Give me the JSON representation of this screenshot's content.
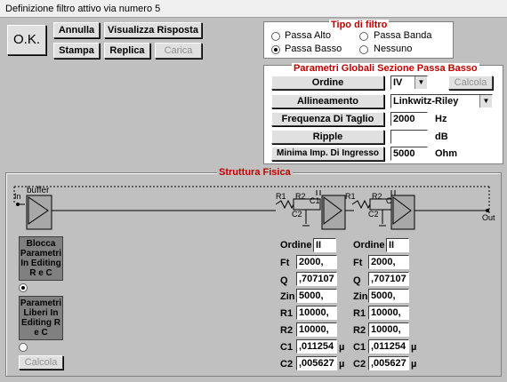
{
  "window": {
    "title": "Definizione filtro attivo via numero 5"
  },
  "toolbar": {
    "ok": "O.K.",
    "annulla": "Annulla",
    "visualizza": "Visualizza Risposta",
    "stampa": "Stampa",
    "replica": "Replica",
    "carica": "Carica"
  },
  "tipo_filtro": {
    "title": "Tipo di filtro",
    "options": [
      "Passa Alto",
      "Passa Banda",
      "Passa Basso",
      "Nessuno"
    ],
    "selected": "Passa Basso"
  },
  "parametri": {
    "title": "Parametri Globali Sezione Passa Basso",
    "ordine_label": "Ordine",
    "ordine_value": "IV",
    "calcola": "Calcola",
    "allineamento_label": "Allineamento",
    "allineamento_value": "Linkwitz-Riley",
    "frequenza_label": "Frequenza Di Taglio",
    "frequenza_value": "2000",
    "frequenza_unit": "Hz",
    "ripple_label": "Ripple",
    "ripple_value": "",
    "ripple_unit": "dB",
    "minima_label": "Minima Imp. Di Ingresso",
    "minima_value": "5000",
    "minima_unit": "Ohm"
  },
  "struttura": {
    "title": "Struttura Fisica",
    "buffer_label": "buffer",
    "in_label": "In",
    "out_label": "Out",
    "r1": "R1",
    "r2": "R2",
    "c1": "C1",
    "c2": "C2",
    "blocca": "Blocca Parametri In Editing R e C",
    "liberi": "Parametri Liberi In Editing R e C",
    "calcola": "Calcola",
    "stages": [
      {
        "ordine": "II",
        "ft": "2000,",
        "q": ",707107",
        "zin": "5000,",
        "r1": "10000,",
        "r2": "10000,",
        "c1": ",011254",
        "c2": ",005627"
      },
      {
        "ordine": "II",
        "ft": "2000,",
        "q": ",707107",
        "zin": "5000,",
        "r1": "10000,",
        "r2": "10000,",
        "c1": ",011254",
        "c2": ",005627"
      }
    ],
    "labels": {
      "ordine": "Ordine",
      "ft": "Ft",
      "q": "Q",
      "zin": "Zin",
      "r1": "R1",
      "r2": "R2",
      "c1": "C1",
      "c2": "C2",
      "mu": "µ"
    }
  }
}
